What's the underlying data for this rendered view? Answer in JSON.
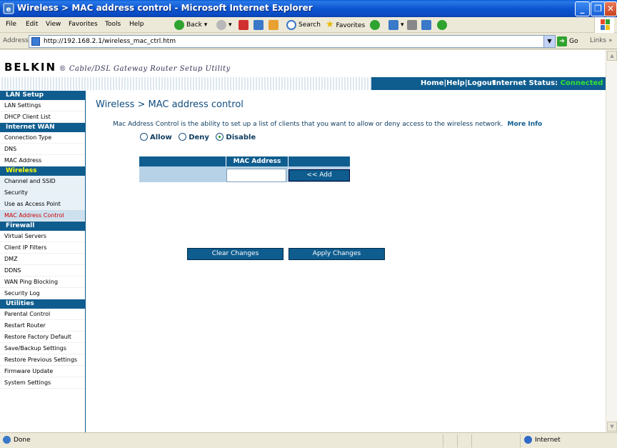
{
  "window": {
    "title": "Wireless > MAC address control - Microsoft Internet Explorer"
  },
  "menu": {
    "items": [
      "File",
      "Edit",
      "View",
      "Favorites",
      "Tools",
      "Help"
    ],
    "toolbar": {
      "back": "Back",
      "search": "Search",
      "favorites": "Favorites"
    }
  },
  "address": {
    "label": "Address",
    "url": "http://192.168.2.1/wireless_mac_ctrl.htm",
    "go": "Go",
    "links": "Links"
  },
  "header": {
    "brand": "BELKIN",
    "subtitle": "Cable/DSL Gateway Router Setup Utility",
    "nav_links": "Home|Help|Logout",
    "status_label": "Internet Status:",
    "status_value": "Connected"
  },
  "sidebar": {
    "sections": [
      {
        "title": "LAN Setup",
        "items": [
          "LAN Settings",
          "DHCP Client List"
        ]
      },
      {
        "title": "Internet WAN",
        "items": [
          "Connection Type",
          "DNS",
          "MAC Address"
        ]
      },
      {
        "title": "Wireless",
        "items": [
          "Channel and SSID",
          "Security",
          "Use as Access Point",
          "MAC Address Control"
        ]
      },
      {
        "title": "Firewall",
        "items": [
          "Virtual Servers",
          "Client IP Filters",
          "DMZ",
          "DDNS",
          "WAN Ping Blocking",
          "Security Log"
        ]
      },
      {
        "title": "Utilities",
        "items": [
          "Parental Control",
          "Restart Router",
          "Restore Factory Default",
          "Save/Backup Settings",
          "Restore Previous Settings",
          "Firmware Update",
          "System Settings"
        ]
      }
    ]
  },
  "main": {
    "title": "Wireless > MAC address control",
    "description": "Mac Address Control is the ability to set up a list of clients that you want to allow or deny access to the wireless network.",
    "more_info": "More Info",
    "radio": {
      "allow": "Allow",
      "deny": "Deny",
      "disable": "Disable",
      "selected": "Disable"
    },
    "table": {
      "header": "MAC Address",
      "input_value": "",
      "add_button": "<< Add"
    },
    "clear_button": "Clear Changes",
    "apply_button": "Apply Changes"
  },
  "statusbar": {
    "left": "Done",
    "zone": "Internet"
  },
  "colors": {
    "title_bar": "#0c55d0",
    "belkin_blue": "#0f5d8f",
    "connected": "#35e035",
    "selected_item": "#d00000"
  }
}
